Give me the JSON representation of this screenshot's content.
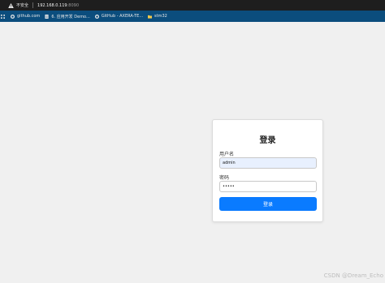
{
  "browser": {
    "security_label": "不安全",
    "url_host": "192.168.0.119",
    "url_port": ":8090"
  },
  "bookmarks": [
    {
      "label": "github.com",
      "icon": "github-icon"
    },
    {
      "label": "6. 应用开发 Demo...",
      "icon": "doc-icon"
    },
    {
      "label": "GitHub - AXERA-TE...",
      "icon": "github-icon"
    },
    {
      "label": "stm32",
      "icon": "folder-icon"
    }
  ],
  "login": {
    "title": "登录",
    "username_label": "用户名",
    "username_value": "admin",
    "password_label": "密码",
    "password_value": "•••••",
    "submit_label": "登录"
  },
  "watermark": "CSDN @Dream_Echo",
  "colors": {
    "background": "#f0f0f0",
    "button": "#0a7bff",
    "bookmark_bar": "#0b4d7d",
    "autofill": "#e8f0fe"
  }
}
